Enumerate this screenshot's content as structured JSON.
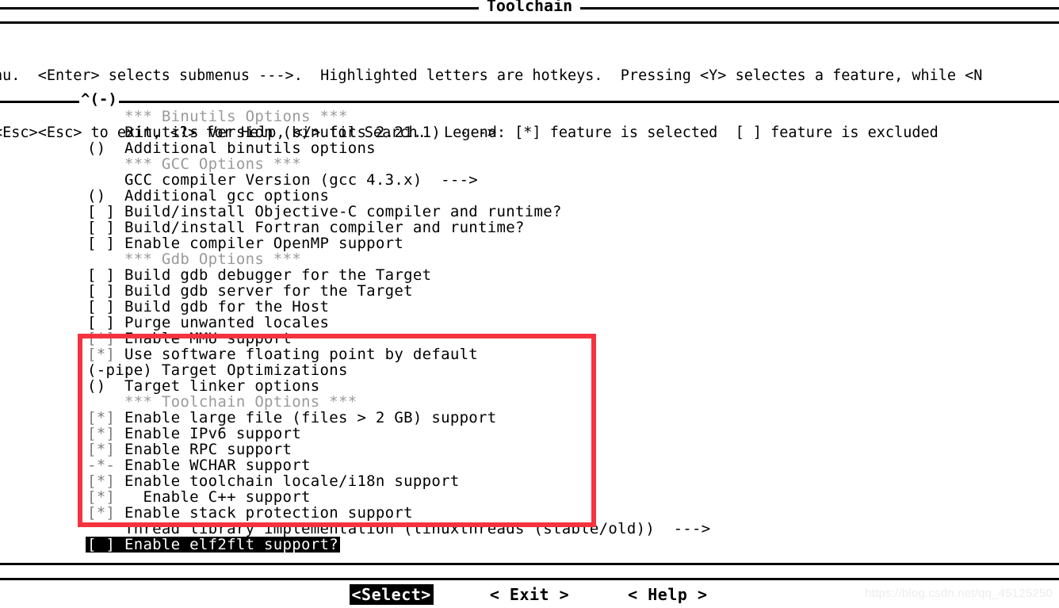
{
  "dialog": {
    "title": "Toolchain",
    "scroll_up_indicator": "^(-)"
  },
  "help": {
    "line1": "nu.  <Enter> selects submenus --->.  Highlighted letters are hotkeys.  Pressing <Y> selectes a feature, while <N",
    "line2": "<Esc><Esc> to exit, <?> for Help, </> for Search.  Legend: [*] feature is selected  [ ] feature is excluded"
  },
  "menu": {
    "rows": [
      {
        "mark": "    ",
        "label": "*** Binutils Options ***",
        "type": "section"
      },
      {
        "mark": "    ",
        "label": "Binutils Version (binutils 2.21.1)  --->",
        "type": "submenu"
      },
      {
        "mark": "()  ",
        "label": "Additional binutils options",
        "type": "string"
      },
      {
        "mark": "    ",
        "label": "*** GCC Options ***",
        "type": "section"
      },
      {
        "mark": "    ",
        "label": "GCC compiler Version (gcc 4.3.x)  --->",
        "type": "submenu"
      },
      {
        "mark": "()  ",
        "label": "Additional gcc options",
        "type": "string"
      },
      {
        "mark": "[ ] ",
        "label": "Build/install Objective-C compiler and runtime?",
        "type": "bool"
      },
      {
        "mark": "[ ] ",
        "label": "Build/install Fortran compiler and runtime?",
        "type": "bool"
      },
      {
        "mark": "[ ] ",
        "label": "Enable compiler OpenMP support",
        "type": "bool"
      },
      {
        "mark": "    ",
        "label": "*** Gdb Options ***",
        "type": "section"
      },
      {
        "mark": "[ ] ",
        "label": "Build gdb debugger for the Target",
        "type": "bool"
      },
      {
        "mark": "[ ] ",
        "label": "Build gdb server for the Target",
        "type": "bool"
      },
      {
        "mark": "[ ] ",
        "label": "Build gdb for the Host",
        "type": "bool"
      },
      {
        "mark": "[ ] ",
        "label": "Purge unwanted locales",
        "type": "bool"
      },
      {
        "mark": "[*] ",
        "label": "Enable MMU support",
        "type": "bool"
      },
      {
        "mark": "[*] ",
        "label": "Use software floating point by default",
        "type": "bool"
      },
      {
        "mark": "(-pipe) ",
        "label": "Target Optimizations",
        "type": "string"
      },
      {
        "mark": "()  ",
        "label": "Target linker options",
        "type": "string"
      },
      {
        "mark": "    ",
        "label": "*** Toolchain Options ***",
        "type": "section"
      },
      {
        "mark": "[*] ",
        "label": "Enable large file (files > 2 GB) support",
        "type": "bool"
      },
      {
        "mark": "[*] ",
        "label": "Enable IPv6 support",
        "type": "bool"
      },
      {
        "mark": "[*] ",
        "label": "Enable RPC support",
        "type": "bool"
      },
      {
        "mark": "-*- ",
        "label": "Enable WCHAR support",
        "type": "bool-locked"
      },
      {
        "mark": "[*] ",
        "label": "Enable toolchain locale/i18n support",
        "type": "bool"
      },
      {
        "mark": "[*] ",
        "label": "  Enable C++ support",
        "type": "bool"
      },
      {
        "mark": "[*] ",
        "label": "Enable stack protection support",
        "type": "bool"
      },
      {
        "mark": "    ",
        "label": "Thread library implementation (linuxthreads (stable/old))  --->",
        "type": "submenu"
      },
      {
        "mark": "[ ] ",
        "label": "Enable elf2flt support?",
        "type": "bool",
        "highlighted": true
      }
    ]
  },
  "buttons": [
    {
      "label": "<Select>",
      "selected": true
    },
    {
      "label": "< Exit >",
      "selected": false
    },
    {
      "label": "< Help >",
      "selected": false
    }
  ],
  "annotation": {
    "color": "#f5333f",
    "shape": "rectangle"
  },
  "watermark": {
    "text": "https://blog.csdn.net/qq_45125250"
  }
}
